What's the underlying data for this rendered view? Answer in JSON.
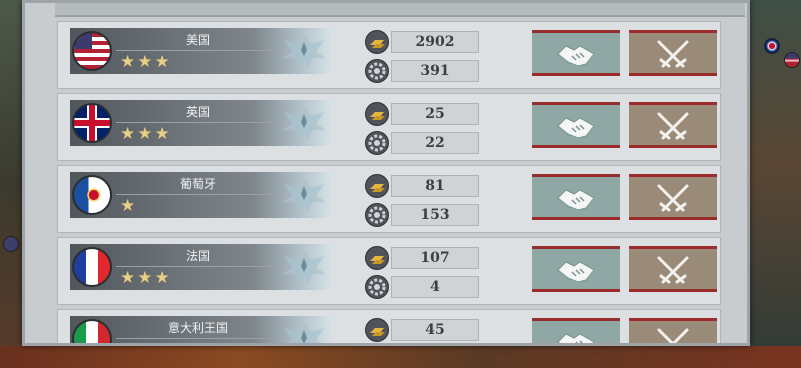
{
  "countries": [
    {
      "name": "美国",
      "stars": 3,
      "flag": "usa-flag",
      "gold": "2902",
      "industry": "391"
    },
    {
      "name": "英国",
      "stars": 3,
      "flag": "uk-flag",
      "gold": "25",
      "industry": "22"
    },
    {
      "name": "葡萄牙",
      "stars": 1,
      "flag": "portugal-flag",
      "gold": "81",
      "industry": "153"
    },
    {
      "name": "法国",
      "stars": 3,
      "flag": "france-flag",
      "gold": "107",
      "industry": "4"
    },
    {
      "name": "意大利王国",
      "stars": 0,
      "flag": "italy-flag",
      "gold": "45",
      "industry": ""
    }
  ],
  "actions": {
    "peace_icon": "handshake-icon",
    "war_icon": "crossed-swords-icon"
  },
  "icons": {
    "gold": "gold-bars-icon",
    "industry": "gear-icon"
  },
  "colors": {
    "peace_button": "#8fa8a6",
    "war_button": "#9a8a78",
    "button_stripe": "#9a2b2b",
    "star": "#e4cf8a"
  }
}
